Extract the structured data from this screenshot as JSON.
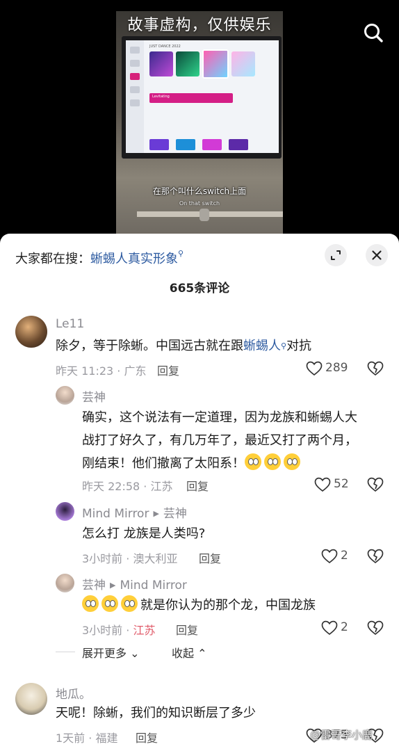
{
  "video": {
    "overlay_title": "故事虚构，仅供娱乐",
    "subtitle_cn": "在那个叫什么switch上面",
    "subtitle_en": "On that switch",
    "tv": {
      "header": "JUST DANCE 2022",
      "song": "Levitating"
    }
  },
  "panel": {
    "suggest_prefix": "大家都在搜：",
    "suggest_keyword": "蜥蜴人真实形象",
    "comment_count_title": "665条评论"
  },
  "comments": [
    {
      "user": "Le11",
      "text_before": "除夕，等于除蜥。中国远古就在跟",
      "keyword": "蜥蜴人",
      "text_after": "对抗",
      "time_loc": "昨天 11:23 · 广东",
      "reply_label": "回复",
      "likes": "289"
    },
    {
      "user": "芸神",
      "text_line1": "确实，这个说法有一定道理，因为龙族和蜥蜴人大",
      "text_line2": "战打了好久了，有几万年了，最近又打了两个月，",
      "text_line3": "刚结束！他们撤离了太阳系！",
      "time_loc": "昨天 22:58 · 江苏",
      "reply_label": "回复",
      "likes": "52"
    },
    {
      "user": "Mind Mirror",
      "reply_to": "芸神",
      "text": "怎么打 龙族是人类吗?",
      "time_loc": "3小时前 · 澳大利亚",
      "reply_label": "回复",
      "likes": "2"
    },
    {
      "user": "芸神",
      "reply_to": "Mind Mirror",
      "text": "就是你认为的那个龙，中国龙族",
      "time": "3小时前 · ",
      "loc": "江苏",
      "reply_label": "回复",
      "likes": "2"
    },
    {
      "user": "地瓜。",
      "text": "天呢！除蜥，我们的知识断层了多少",
      "time_loc": "1天前 · 福建",
      "reply_label": "回复",
      "likes": "375"
    }
  ],
  "thread_controls": {
    "expand_more": "展开更多",
    "collapse": "收起"
  },
  "watermark": "@雷哥李小鹿",
  "colors": {
    "accent_link": "#2c5aa0",
    "location_red": "#e05b6a"
  }
}
